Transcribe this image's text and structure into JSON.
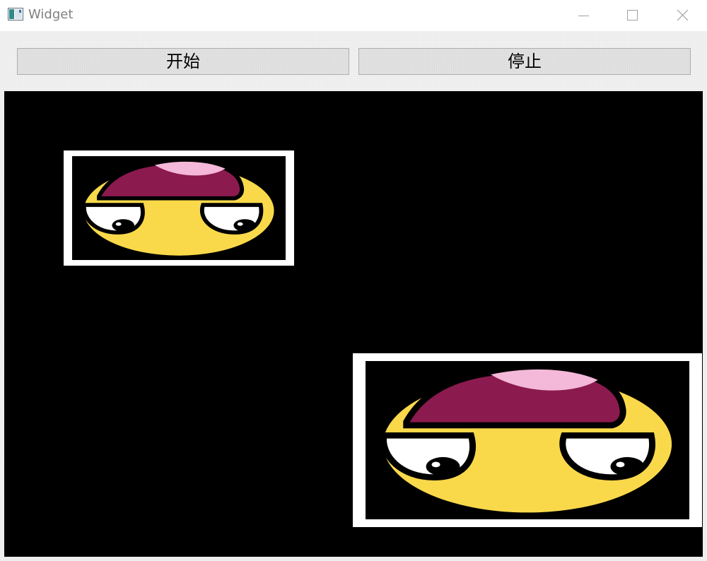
{
  "window": {
    "title": "Widget",
    "icon": "app-window-icon",
    "controls": {
      "minimize_icon": "minimize-icon",
      "maximize_icon": "maximize-icon",
      "close_icon": "close-icon"
    }
  },
  "toolbar": {
    "start_label": "开始",
    "stop_label": "停止"
  },
  "canvas": {
    "background": "#000000",
    "sprites": [
      {
        "name": "emoji-face-small",
        "depicts": "emoji-face-icon"
      },
      {
        "name": "emoji-face-large",
        "depicts": "emoji-face-icon"
      }
    ]
  },
  "colors": {
    "face": "#f9d94a",
    "brain": "#8b1a4f",
    "highlight": "#f4b8d8",
    "frame": "#ffffff"
  }
}
